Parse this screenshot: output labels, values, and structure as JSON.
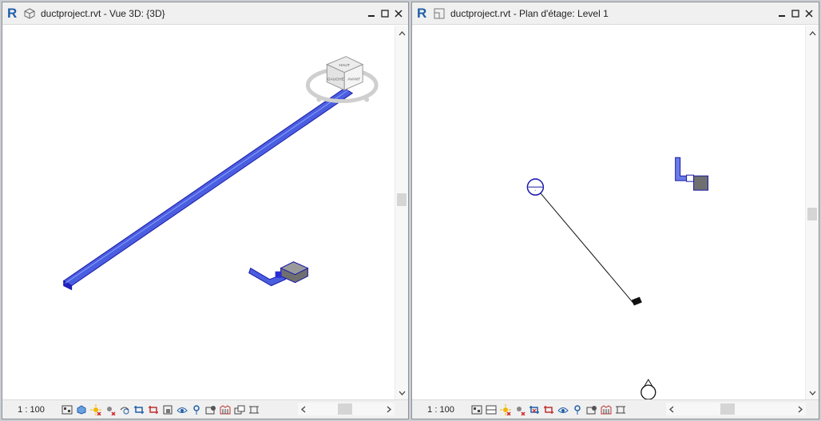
{
  "left_window": {
    "title": "ductproject.rvt - Vue 3D: {3D}",
    "scale": "1 : 100",
    "viewcube": {
      "top_face": "HAUT",
      "left_face": "GAUCHE",
      "right_face": "AVANT"
    }
  },
  "right_window": {
    "title": "ductproject.rvt - Plan d'étage: Level 1",
    "scale": "1 : 100"
  },
  "colors": {
    "duct": "#2b2bd6",
    "logo": "#1f5fa8",
    "element_gray": "#6f6f6f"
  }
}
